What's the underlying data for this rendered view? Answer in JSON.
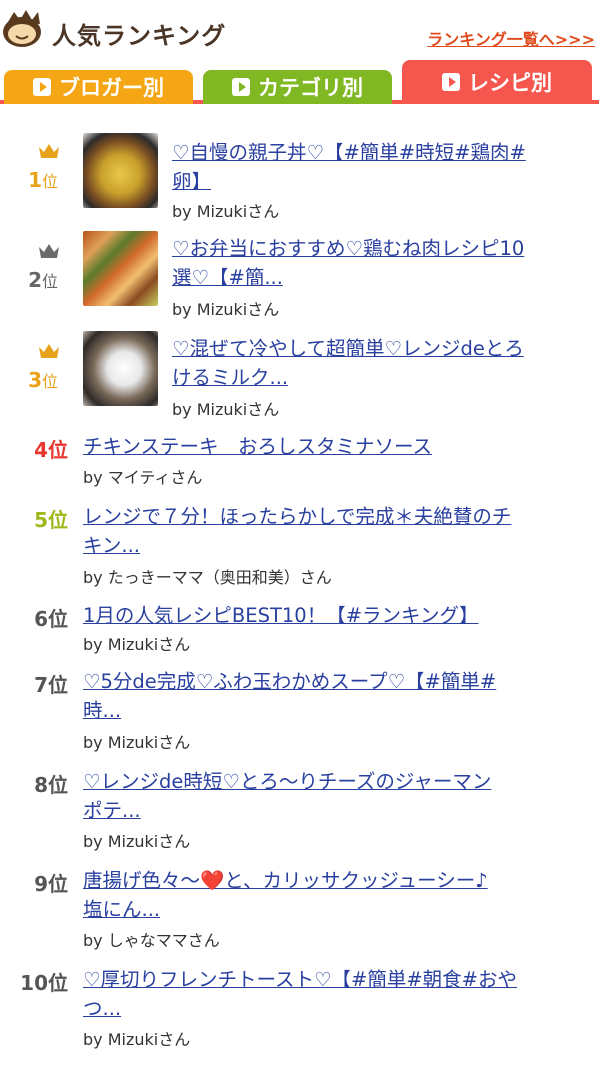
{
  "header": {
    "title": "人気ランキング",
    "all_link": "ランキング一覧へ>>>"
  },
  "tabs": [
    {
      "label": "ブロガー別"
    },
    {
      "label": "カテゴリ別"
    },
    {
      "label": "レシピ別",
      "active": true
    }
  ],
  "colors": {
    "gold": "#e8a219",
    "silver": "#7a7a7a",
    "bronze": "#e8a219",
    "rank4": "#e8362e",
    "rank5": "#9cb81c",
    "link": "#2a40a0",
    "tab_active": "#f5574f"
  },
  "items": [
    {
      "rank": "1",
      "suffix": "位",
      "title_line1": "♡自慢の親子丼♡【#簡単#時短#鶏肉#",
      "title_line2": "卵】",
      "author": "by Mizukiさん"
    },
    {
      "rank": "2",
      "suffix": "位",
      "title_line1": "♡お弁当におすすめ♡鶏むね肉レシピ10",
      "title_line2": "選♡【#簡...",
      "author": "by Mizukiさん"
    },
    {
      "rank": "3",
      "suffix": "位",
      "title_line1": "♡混ぜて冷やして超簡単♡レンジdeとろ",
      "title_line2": "けるミルク...",
      "author": "by Mizukiさん"
    },
    {
      "rank": "4位",
      "title_line1": "チキンステーキ　おろしスタミナソース",
      "author": "by マイティさん"
    },
    {
      "rank": "5位",
      "title_line1": "レンジで７分！ほったらかしで完成＊夫絶賛のチ",
      "title_line2": "キン...",
      "author": "by たっきーママ（奥田和美）さん"
    },
    {
      "rank": "6位",
      "title_line1": "1月の人気レシピBEST10！【#ランキング】",
      "author": "by Mizukiさん"
    },
    {
      "rank": "7位",
      "title_line1": "♡5分de完成♡ふわ玉わかめスープ♡【#簡単#",
      "title_line2": "時...",
      "author": "by Mizukiさん"
    },
    {
      "rank": "8位",
      "title_line1": "♡レンジde時短♡とろ～りチーズのジャーマン",
      "title_line2": "ポテ...",
      "author": "by Mizukiさん"
    },
    {
      "rank": "9位",
      "title_line1": "唐揚げ色々～❤️と、カリッサクッジューシー♪",
      "title_line2": "塩にん...",
      "author": "by しゃなママさん"
    },
    {
      "rank": "10位",
      "title_line1": "♡厚切りフレンチトースト♡【#簡単#朝食#おや",
      "title_line2": "つ...",
      "author": "by Mizukiさん"
    }
  ]
}
